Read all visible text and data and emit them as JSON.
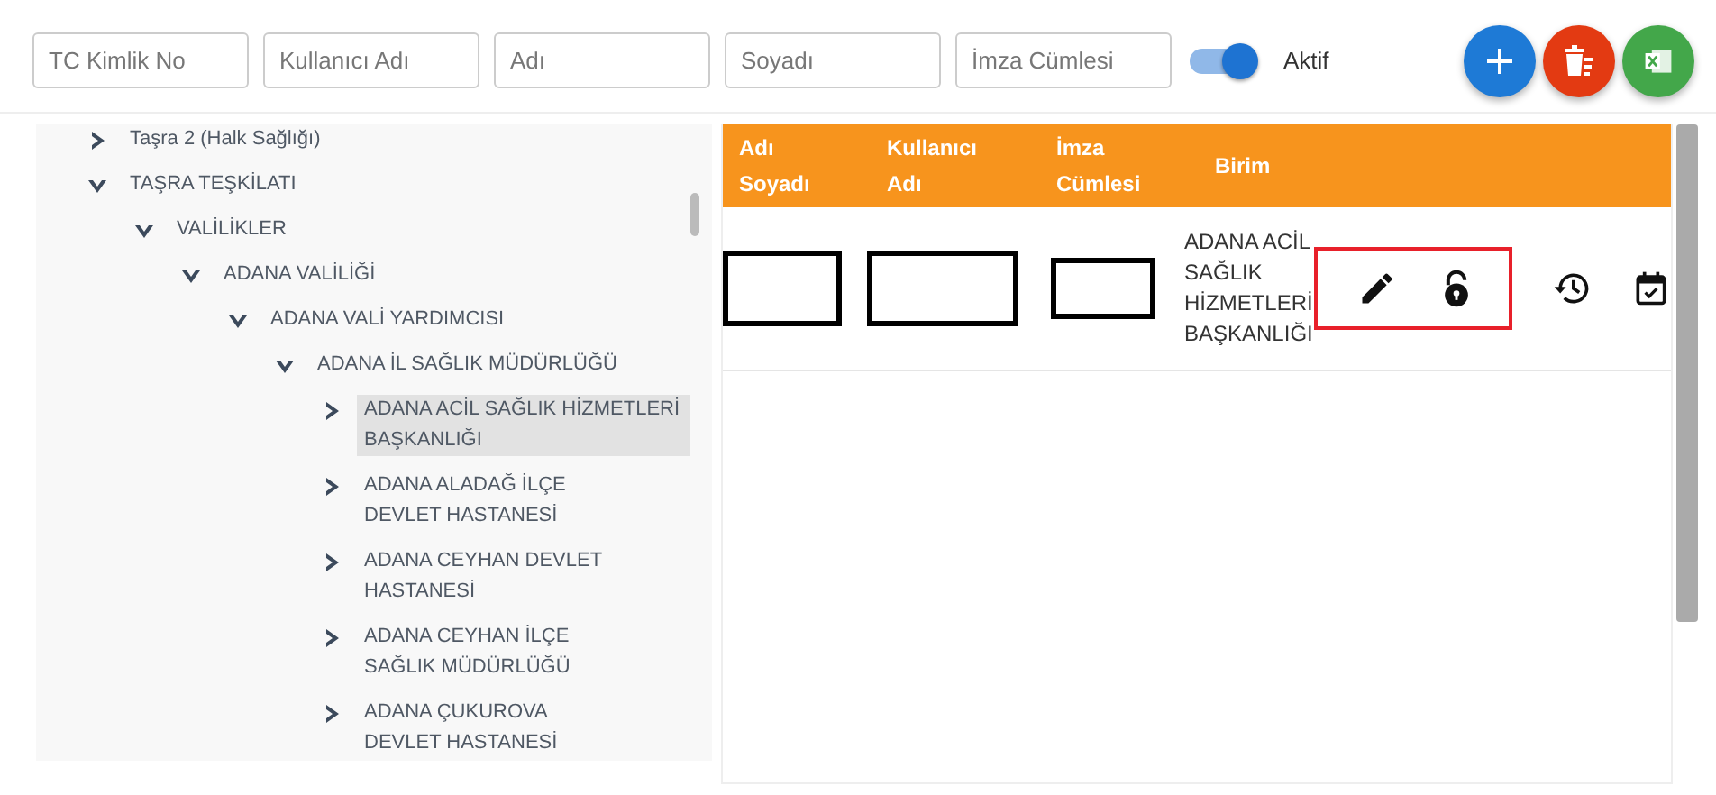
{
  "filters": [
    {
      "placeholder": "TC Kimlik No"
    },
    {
      "placeholder": "Kullanıcı Adı"
    },
    {
      "placeholder": "Adı"
    },
    {
      "placeholder": "Soyadı"
    },
    {
      "placeholder": "İmza Cümlesi"
    }
  ],
  "active_toggle": {
    "label": "Aktif",
    "on": true
  },
  "action_buttons": [
    {
      "kind": "add",
      "color": "#1e7ad6"
    },
    {
      "kind": "delete",
      "color": "#e33a12"
    },
    {
      "kind": "excel",
      "color": "#43a74a"
    }
  ],
  "tree": [
    {
      "label": "Taşra 2 (Halk Sağlığı)",
      "expanded": false,
      "selected": false
    },
    {
      "label": "TAŞRA TEŞKİLATI",
      "expanded": true,
      "selected": false,
      "children": [
        {
          "label": "VALİLİKLER",
          "expanded": true,
          "selected": false,
          "children": [
            {
              "label": "ADANA VALİLİĞİ",
              "expanded": true,
              "selected": false,
              "children": [
                {
                  "label": "ADANA VALİ YARDIMCISI",
                  "expanded": true,
                  "selected": false,
                  "children": [
                    {
                      "label": "ADANA İL SAĞLIK MÜDÜRLÜĞÜ",
                      "expanded": true,
                      "selected": false,
                      "children": [
                        {
                          "label": "ADANA ACİL SAĞLIK HİZMETLERİ BAŞKANLIĞI",
                          "expanded": false,
                          "selected": true
                        },
                        {
                          "label": "ADANA ALADAĞ İLÇE DEVLET HASTANESİ",
                          "expanded": false,
                          "selected": false
                        },
                        {
                          "label": "ADANA CEYHAN DEVLET HASTANESİ",
                          "expanded": false,
                          "selected": false
                        },
                        {
                          "label": "ADANA CEYHAN İLÇE SAĞLIK MÜDÜRLÜĞÜ",
                          "expanded": false,
                          "selected": false
                        },
                        {
                          "label": "ADANA ÇUKUROVA DEVLET HASTANESİ",
                          "expanded": false,
                          "selected": false
                        }
                      ]
                    }
                  ]
                }
              ]
            }
          ]
        }
      ]
    }
  ],
  "table": {
    "columns": [
      {
        "lines": [
          "Adı",
          "Soyadı"
        ]
      },
      {
        "lines": [
          "Kullanıcı",
          "Adı"
        ]
      },
      {
        "lines": [
          "İmza",
          "Cümlesi"
        ]
      },
      {
        "lines": [
          "Birim"
        ]
      }
    ],
    "rows": [
      {
        "cells": [
          {
            "kind": "redacted"
          },
          {
            "kind": "redacted"
          },
          {
            "kind": "redacted"
          },
          {
            "kind": "text",
            "text": "ADANA ACİL SAĞLIK HİZMETLERİ BAŞKANLIĞI"
          }
        ],
        "framed_actions": [
          {
            "kind": "edit"
          },
          {
            "kind": "unlock"
          }
        ],
        "actions": [
          {
            "kind": "history"
          },
          {
            "kind": "calendar"
          }
        ]
      }
    ]
  }
}
